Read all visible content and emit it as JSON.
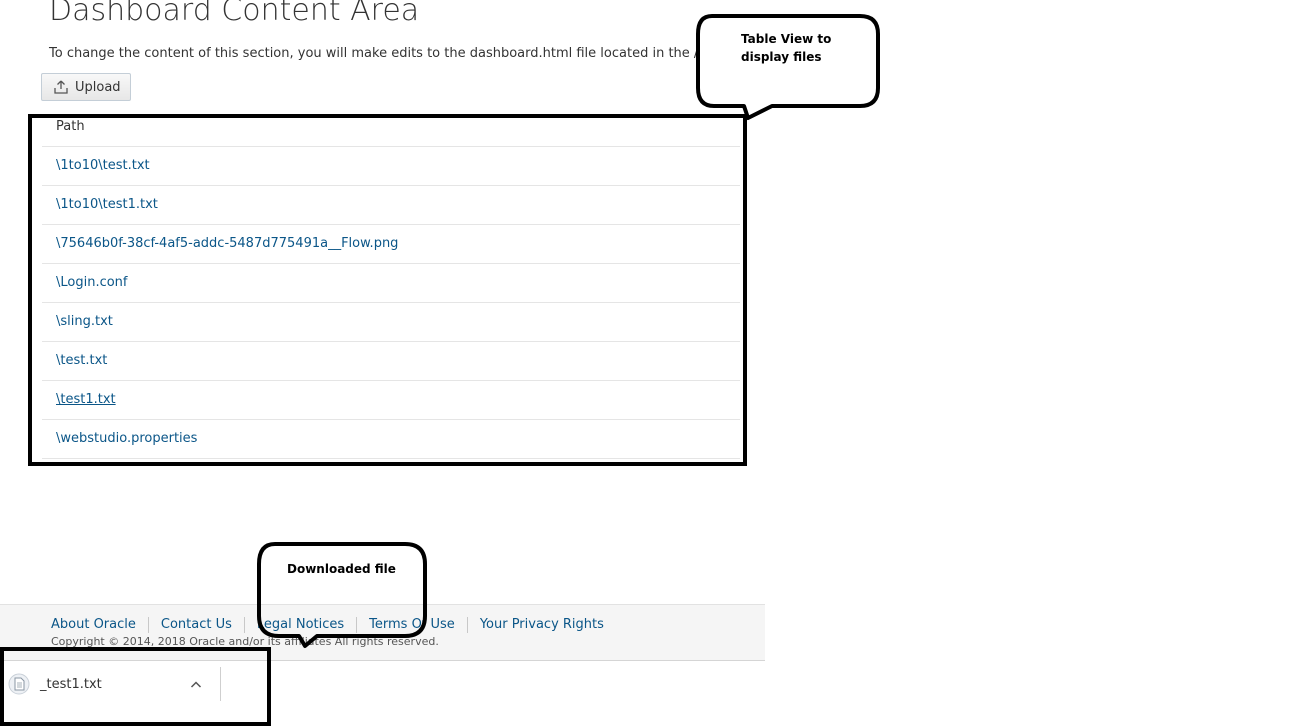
{
  "dashboard": {
    "title": "Dashboard Content Area",
    "description": "To change the content of this section, you will make edits to the dashboard.html file located in the /js/views folder."
  },
  "toolbar": {
    "upload_label": "Upload",
    "upload_icon": "upload-icon"
  },
  "table": {
    "header": "Path",
    "rows": [
      "\\1to10\\test.txt",
      "\\1to10\\test1.txt",
      "\\75646b0f-38cf-4af5-addc-5487d775491a__Flow.png",
      "\\Login.conf",
      "\\sling.txt",
      "\\test.txt",
      "\\test1.txt",
      "\\webstudio.properties"
    ]
  },
  "annotations": {
    "table_callout": "Table View to display files",
    "download_callout": "Downloaded file"
  },
  "footer": {
    "links": [
      "About Oracle",
      "Contact Us",
      "Legal Notices",
      "Terms Of Use",
      "Your Privacy Rights"
    ],
    "copyright": "Copyright © 2014, 2018 Oracle and/or its affiliates All rights reserved."
  },
  "download_bar": {
    "file_name": "_test1.txt",
    "file_icon": "document-icon",
    "menu_icon": "chevron-up-icon"
  },
  "colors": {
    "link": "#0b5688",
    "text": "#333333",
    "annotation": "#000000",
    "footer_bg": "#f5f5f5"
  }
}
